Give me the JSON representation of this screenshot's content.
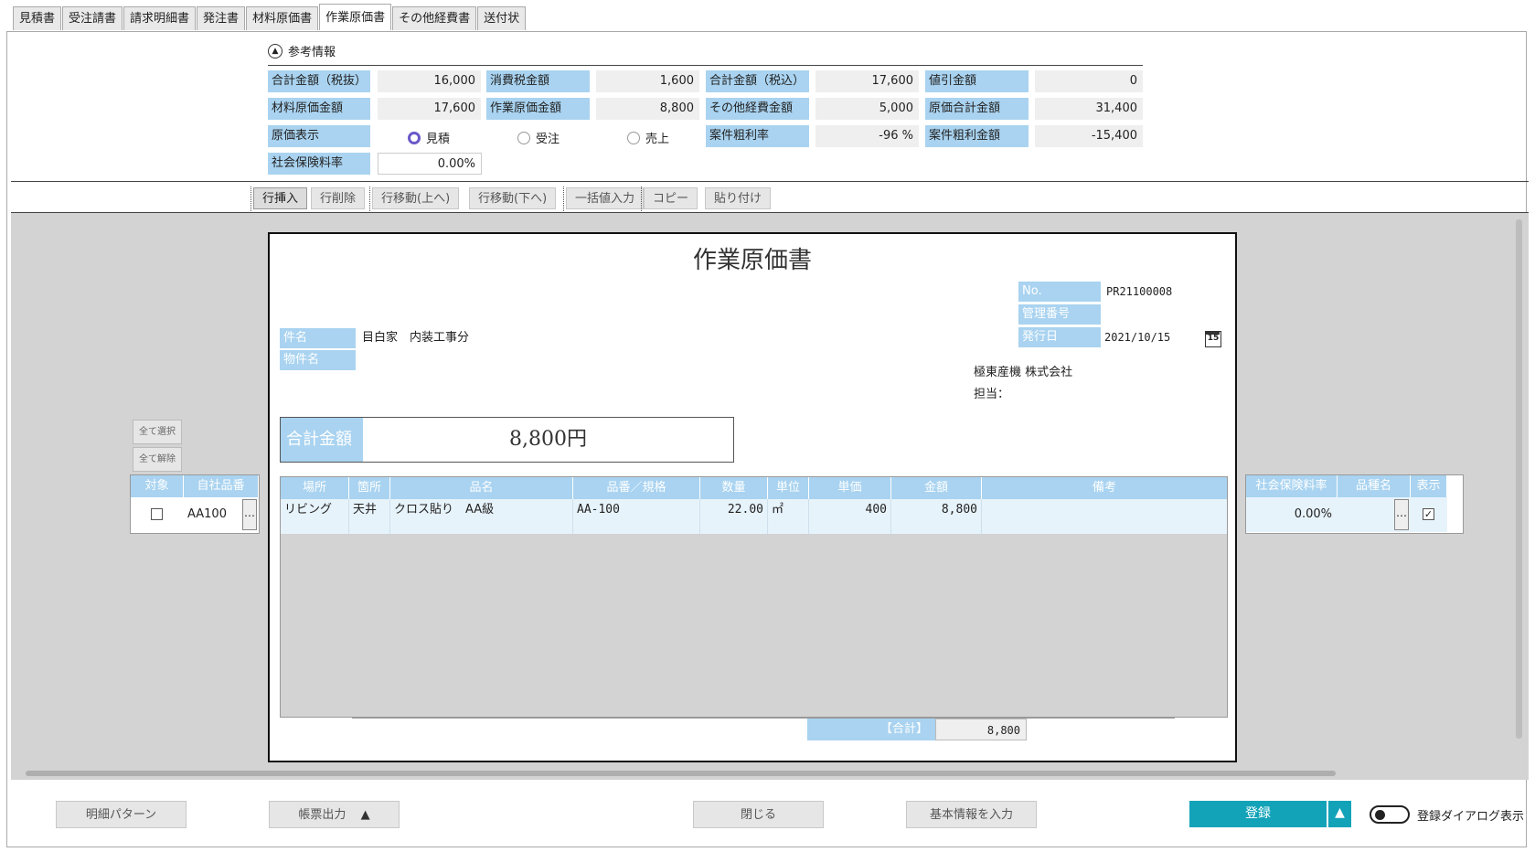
{
  "tabs": [
    "見積書",
    "受注請書",
    "請求明細書",
    "発注書",
    "材料原価書",
    "作業原価書",
    "その他経費書",
    "送付状"
  ],
  "active_tab": 5,
  "ref_title": "参考情報",
  "ref": {
    "row1": [
      [
        "合計金額（税抜）",
        "16,000"
      ],
      [
        "消費税金額",
        "1,600"
      ],
      [
        "合計金額（税込）",
        "17,600"
      ],
      [
        "値引金額",
        "0"
      ]
    ],
    "row2": [
      [
        "材料原価金額",
        "17,600"
      ],
      [
        "作業原価金額",
        "8,800"
      ],
      [
        "その他経費金額",
        "5,000"
      ],
      [
        "原価合計金額",
        "31,400"
      ]
    ],
    "row3_label": "原価表示",
    "radios": [
      "見積",
      "受注",
      "売上"
    ],
    "radio_selected": 0,
    "row3_right": [
      [
        "案件粗利率",
        "-96 %"
      ],
      [
        "案件粗利金額",
        "-15,400"
      ]
    ],
    "row4": [
      "社会保険料率",
      "0.00%"
    ]
  },
  "toolbar": [
    "行挿入",
    "行削除",
    "行移動(上へ)",
    "行移動(下へ)",
    "一括値入力",
    "コピー",
    "貼り付け"
  ],
  "doc": {
    "title": "作業原価書",
    "no_label": "No.",
    "no_value": "PR21100008",
    "mgmt_label": "管理番号",
    "mgmt_value": "",
    "issue_label": "発行日",
    "issue_value": "2021/10/15",
    "calendar_day": "15",
    "subject_label": "件名",
    "subject_value": "目白家　内装工事分",
    "property_label": "物件名",
    "property_value": "",
    "company": "極東産機 株式会社",
    "person_label": "担当：",
    "total_label": "合計金額",
    "total_value": "8,800円",
    "columns": [
      "場所",
      "箇所",
      "品名",
      "品番／規格",
      "数量",
      "単位",
      "単価",
      "金額",
      "備考"
    ],
    "rows": [
      [
        "リビング",
        "天井",
        "クロス貼り　AA級",
        "AA-100",
        "22.00",
        "㎡",
        "400",
        "8,800",
        ""
      ]
    ],
    "sum_label": "【合計】",
    "sum_value": "8,800"
  },
  "left_grid": {
    "select_all": "全て選択",
    "clear_all": "全て解除",
    "columns": [
      "対象",
      "自社品番"
    ],
    "rows": [
      {
        "checked": false,
        "code": "AA100"
      }
    ]
  },
  "right_grid": {
    "columns": [
      "社会保険料率",
      "品種名",
      "表示"
    ],
    "rows": [
      {
        "rate": "0.00%",
        "kind": "",
        "shown": true
      }
    ]
  },
  "footer": {
    "pattern": "明細パターン",
    "output": "帳票出力",
    "close": "閉じる",
    "basic": "基本情報を入力",
    "register": "登録",
    "dialog_toggle": "登録ダイアログ表示"
  },
  "colors": {
    "label_bg": "#a9d3f0",
    "primary": "#13a3b8",
    "radio": "#6b58c9"
  }
}
